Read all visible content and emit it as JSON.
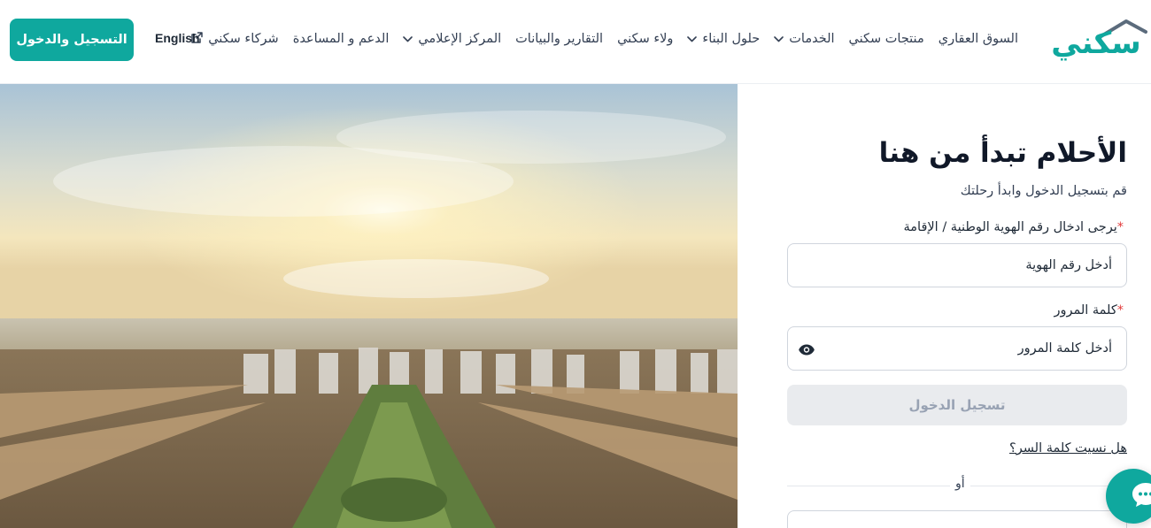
{
  "header": {
    "logo_text": "سكني",
    "nav": [
      {
        "label": "السوق العقاري",
        "icon": ""
      },
      {
        "label": "منتجات سكني",
        "icon": ""
      },
      {
        "label": "الخدمات",
        "icon": "chevron-down-icon"
      },
      {
        "label": "حلول البناء",
        "icon": "chevron-down-icon"
      },
      {
        "label": "ولاء سكني",
        "icon": ""
      },
      {
        "label": "التقارير والبيانات",
        "icon": ""
      },
      {
        "label": "المركز الإعلامي",
        "icon": "chevron-down-icon"
      },
      {
        "label": "الدعم و المساعدة",
        "icon": ""
      },
      {
        "label": "شركاء سكني",
        "icon": "external-link-icon"
      }
    ],
    "language_label": "English",
    "register_label": "التسجيل والدخول"
  },
  "form": {
    "title": "الأحلام تبدأ من هنا",
    "subtitle": "قم بتسجيل الدخول وابدأ رحلتك",
    "id_label": "يرجى ادخال رقم الهوية الوطنية / الإقامة",
    "id_placeholder": "أدخل رقم الهوية",
    "password_label": "كلمة المرور",
    "password_placeholder": "أدخل كلمة المرور",
    "required_mark": "*",
    "login_label": "تسجيل الدخول",
    "forgot_label": "هل نسيت كلمة السر؟",
    "or_label": "أو"
  },
  "colors": {
    "brand": "#0fa89e",
    "required": "#e23a3a",
    "disabled_button": "#e9ebee"
  }
}
